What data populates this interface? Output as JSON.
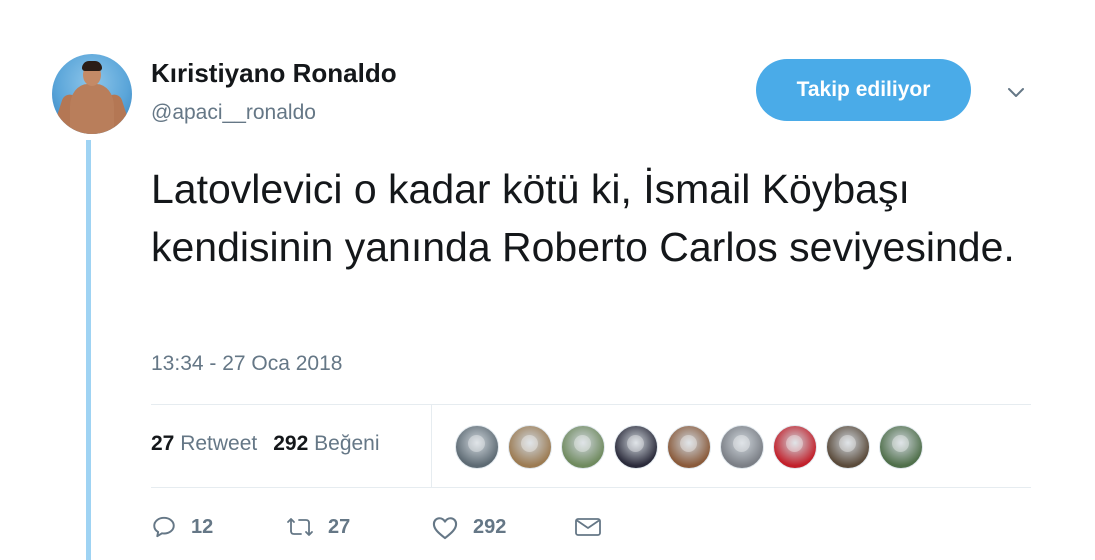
{
  "author": {
    "display_name": "Kıristiyano Ronaldo",
    "username": "@apaci__ronaldo"
  },
  "follow_button": {
    "label": "Takip ediliyor",
    "color": "#4aabe8"
  },
  "tweet": {
    "text": "Latovlevici o kadar kötü ki, İsmail Köybaşı kendisinin yanında Roberto Carlos seviyesinde.",
    "timestamp": "13:34 - 27 Oca 2018"
  },
  "stats": {
    "retweets_count": "27",
    "retweets_label": "Retweet",
    "likes_count": "292",
    "likes_label": "Beğeni"
  },
  "likers": [
    {
      "icon": "liker-avatar-1",
      "color": "#5d6a73"
    },
    {
      "icon": "liker-avatar-2",
      "color": "#9c7b52"
    },
    {
      "icon": "liker-avatar-3",
      "color": "#6f8a5e"
    },
    {
      "icon": "liker-avatar-4",
      "color": "#2a2a3a"
    },
    {
      "icon": "liker-avatar-5",
      "color": "#8a5a3a"
    },
    {
      "icon": "liker-avatar-6",
      "color": "#7b7f86"
    },
    {
      "icon": "liker-avatar-7",
      "color": "#c21f2a"
    },
    {
      "icon": "liker-avatar-8",
      "color": "#5a4a3a"
    },
    {
      "icon": "liker-avatar-9",
      "color": "#4f6f4a"
    }
  ],
  "actions": {
    "reply_count": "12",
    "retweet_count": "27",
    "like_count": "292"
  },
  "colors": {
    "text_secondary": "#657786",
    "thread_line": "#9fd3f3",
    "divider": "#e6ecf0"
  }
}
